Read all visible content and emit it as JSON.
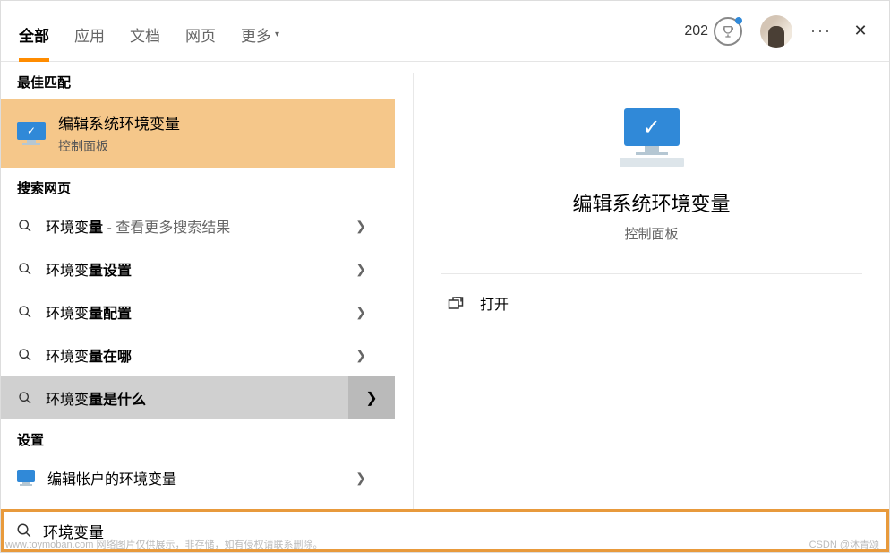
{
  "header": {
    "tabs": [
      "全部",
      "应用",
      "文档",
      "网页",
      "更多"
    ],
    "points": "202"
  },
  "left": {
    "best_match_header": "最佳匹配",
    "best_match": {
      "title": "编辑系统环境变量",
      "subtitle": "控制面板"
    },
    "web_header": "搜索网页",
    "web_items": [
      {
        "prefix": "环境变",
        "bold": "量",
        "suffix": " - 查看更多搜索结果"
      },
      {
        "prefix": "环境变",
        "bold": "量设置",
        "suffix": ""
      },
      {
        "prefix": "环境变",
        "bold": "量配置",
        "suffix": ""
      },
      {
        "prefix": "环境变",
        "bold": "量在哪",
        "suffix": ""
      },
      {
        "prefix": "环境变",
        "bold": "量是什么",
        "suffix": ""
      }
    ],
    "settings_header": "设置",
    "settings_item": "编辑帐户的环境变量"
  },
  "right": {
    "title": "编辑系统环境变量",
    "subtitle": "控制面板",
    "open": "打开"
  },
  "search": {
    "value": "环境变量"
  },
  "watermarks": {
    "left": "www.toymoban.com 网络图片仅供展示，非存储，如有侵权请联系删除。",
    "right": "CSDN @沐青颂"
  }
}
